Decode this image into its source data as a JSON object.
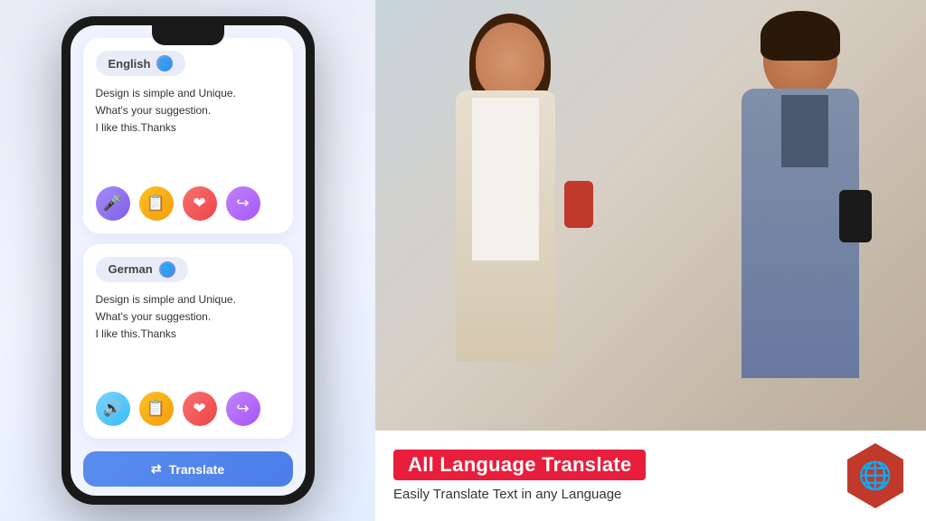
{
  "left_panel": {
    "background": "#e8eaf6"
  },
  "phone": {
    "card1": {
      "language": "English",
      "text": "Design is simple and Unique.\nWhat's your suggestion.\nI like this.Thanks",
      "actions": [
        "mic",
        "copy",
        "favorite",
        "share"
      ]
    },
    "card2": {
      "language": "German",
      "text": "Design is simple and Unique.\nWhat's your suggestion.\nI like this.Thanks",
      "actions": [
        "speaker",
        "copy",
        "favorite",
        "share"
      ]
    },
    "translate_button": "Translate"
  },
  "banner": {
    "title": "All Language Translate",
    "subtitle": "Easily Translate Text in any  Language"
  },
  "icons": {
    "globe": "🌐",
    "mic": "🎤",
    "copy": "📋",
    "heart": "❤",
    "share": "📤",
    "speaker": "🔊",
    "translate_icon": "🔄"
  }
}
